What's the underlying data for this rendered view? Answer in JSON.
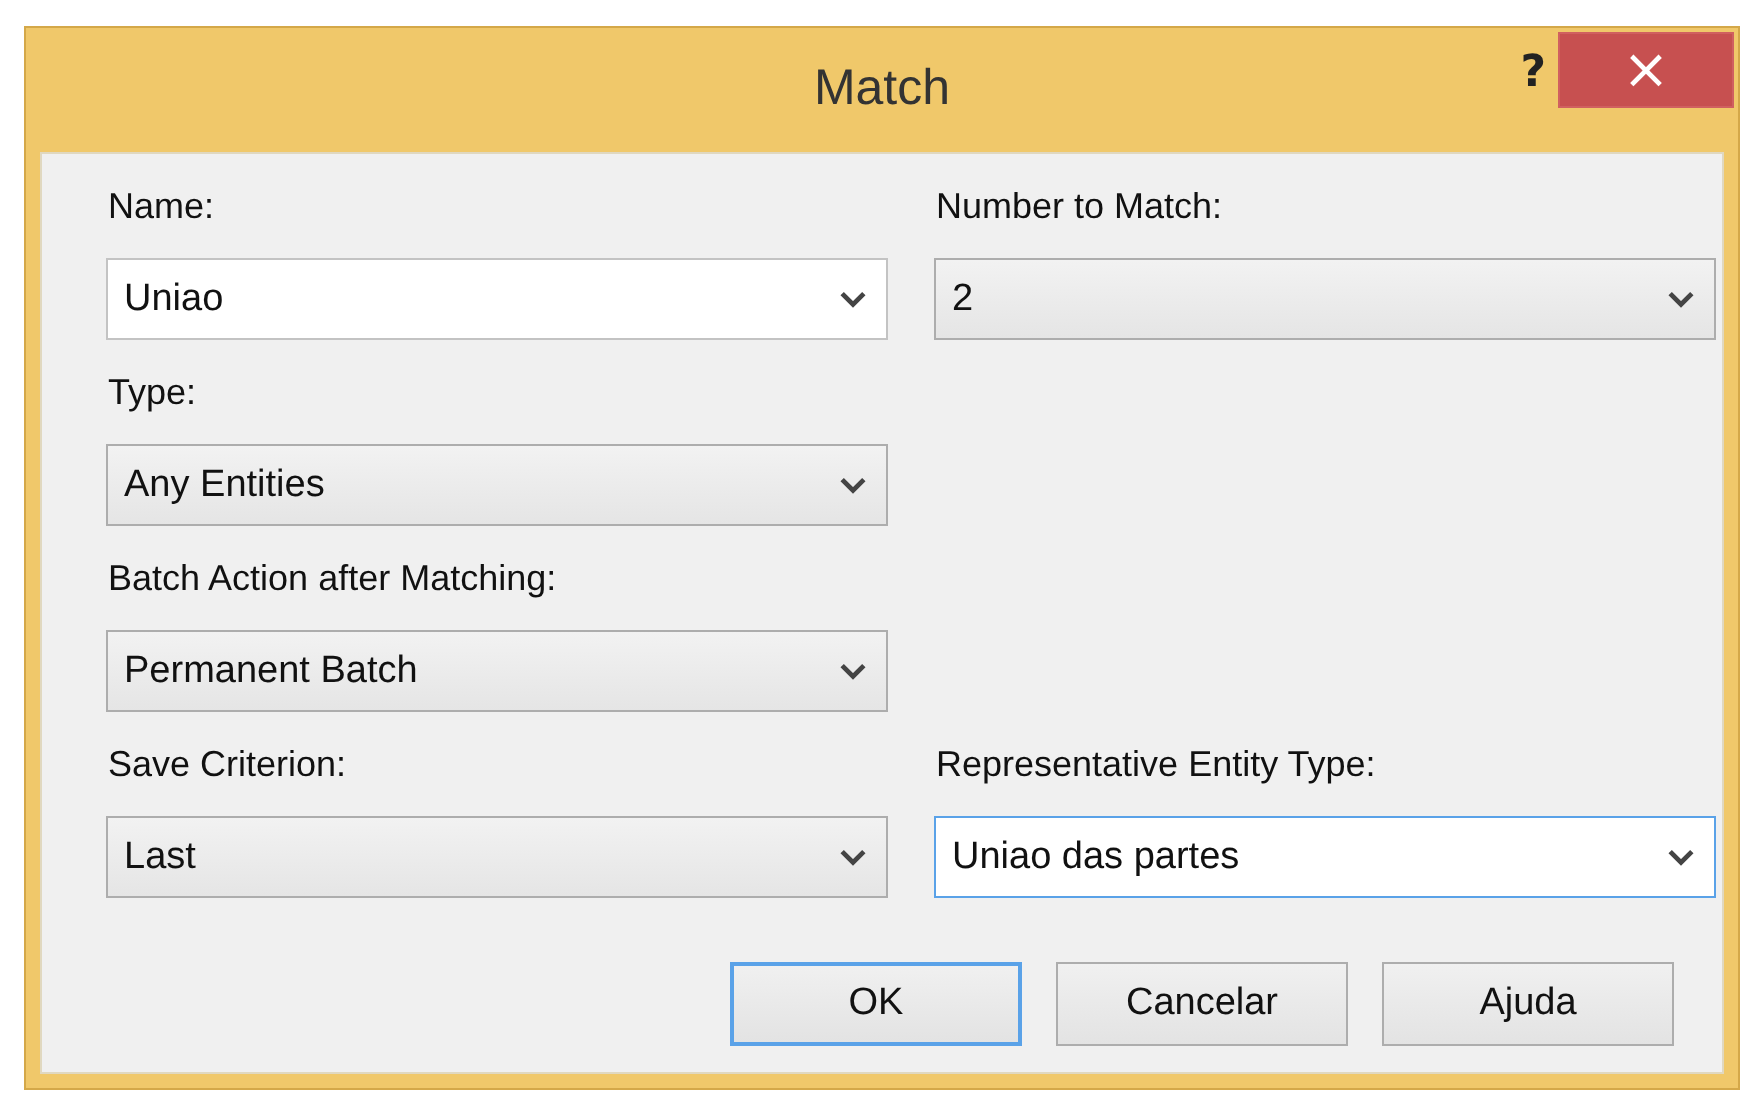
{
  "window": {
    "title": "Match",
    "help": "?",
    "close": "×"
  },
  "rows": [
    {
      "left": {
        "label": "Name:",
        "value": "Uniao",
        "kind": "editable",
        "focused": false
      },
      "right": {
        "label": "Number to Match:",
        "value": "2",
        "kind": "list",
        "focused": false
      }
    },
    {
      "left": {
        "label": "Type:",
        "value": "Any Entities",
        "kind": "list",
        "focused": false
      }
    },
    {
      "left": {
        "label": "Batch Action after Matching:",
        "value": "Permanent Batch",
        "kind": "list",
        "focused": false
      }
    },
    {
      "left": {
        "label": "Save Criterion:",
        "value": "Last",
        "kind": "list",
        "focused": false
      },
      "right": {
        "label": "Representative Entity Type:",
        "value": "Uniao das partes",
        "kind": "editable",
        "focused": true
      }
    }
  ],
  "buttons": [
    {
      "label": "OK",
      "default": true
    },
    {
      "label": "Cancelar",
      "default": false
    },
    {
      "label": "Ajuda",
      "default": false
    }
  ]
}
